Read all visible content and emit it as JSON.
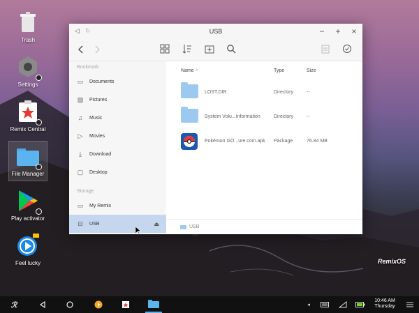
{
  "desktop": {
    "icons": [
      {
        "label": "Trash",
        "icon": "trash-icon"
      },
      {
        "label": "Settings",
        "icon": "settings-icon"
      },
      {
        "label": "Remix Central",
        "icon": "remix-central-icon"
      },
      {
        "label": "File Manager",
        "icon": "file-manager-icon"
      },
      {
        "label": "Play activator",
        "icon": "play-store-icon"
      },
      {
        "label": "Feel lucky",
        "icon": "feel-lucky-icon"
      }
    ],
    "watermark": "RemixOS"
  },
  "window": {
    "title": "USB",
    "controls": {
      "minimize": "−",
      "maximize": "+",
      "close": "×"
    },
    "sidebar": {
      "bookmark_header": "Bookmark",
      "bookmarks": [
        {
          "label": "Documents",
          "icon": "document-icon"
        },
        {
          "label": "Pictures",
          "icon": "picture-icon"
        },
        {
          "label": "Music",
          "icon": "music-icon"
        },
        {
          "label": "Movies",
          "icon": "movie-icon"
        },
        {
          "label": "Download",
          "icon": "download-icon"
        },
        {
          "label": "Desktop",
          "icon": "desktop-icon"
        }
      ],
      "storage_header": "Storage",
      "storage": [
        {
          "label": "My Remix",
          "icon": "monitor-icon"
        },
        {
          "label": "USB",
          "icon": "usb-drive-icon"
        }
      ]
    },
    "columns": {
      "name": "Name",
      "type": "Type",
      "size": "Size"
    },
    "files": [
      {
        "name": "LOST.DIR",
        "type": "Directory",
        "size": "--",
        "icon": "folder-icon"
      },
      {
        "name": "System Volu...Information",
        "type": "Directory",
        "size": "--",
        "icon": "folder-icon"
      },
      {
        "name": "Pokémon GO...ure.com.apk",
        "type": "Package",
        "size": "76.84 MB",
        "icon": "pokeball-icon"
      }
    ],
    "footer_path": "USB"
  },
  "taskbar": {
    "time": "10:46 AM",
    "day": "Thursday"
  },
  "colors": {
    "selection": "#c5d7ee",
    "folder": "#9cc9f0",
    "taskbar": "#111111",
    "battery": "#7ed321"
  }
}
